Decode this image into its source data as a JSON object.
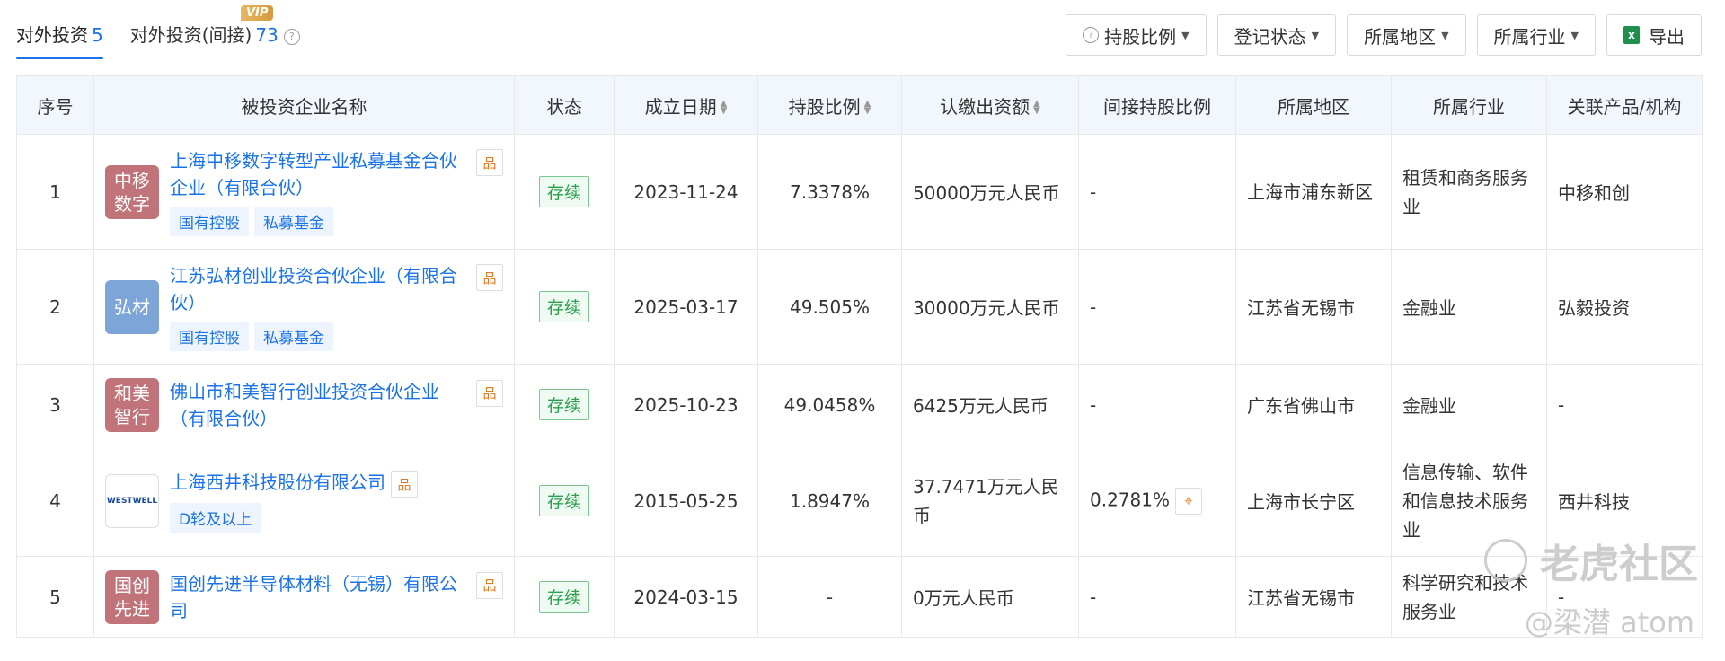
{
  "tabs": [
    {
      "label": "对外投资",
      "count": "5"
    },
    {
      "label": "对外投资(间接)",
      "count": "73"
    }
  ],
  "vip_badge": "VIP",
  "filters": {
    "holding_ratio": "持股比例",
    "reg_status": "登记状态",
    "region": "所属地区",
    "industry": "所属行业",
    "export": "导出"
  },
  "columns": [
    "序号",
    "被投资企业名称",
    "状态",
    "成立日期",
    "持股比例",
    "认缴出资额",
    "间接持股比例",
    "所属地区",
    "所属行业",
    "关联产品/机构"
  ],
  "rows": [
    {
      "index": "1",
      "logo_text": "中移数字",
      "logo_color": "#c0747a",
      "name": "上海中移数字转型产业私募基金合伙企业（有限合伙）",
      "tags": [
        "国有控股",
        "私募基金"
      ],
      "status": "存续",
      "date": "2023-11-24",
      "ratio": "7.3378%",
      "capital": "50000万元人民币",
      "indirect": "-",
      "region": "上海市浦东新区",
      "industry": "租赁和商务服务业",
      "product": "中移和创"
    },
    {
      "index": "2",
      "logo_text": "弘材",
      "logo_color": "#7ea5d8",
      "name": "江苏弘材创业投资合伙企业（有限合伙）",
      "tags": [
        "国有控股",
        "私募基金"
      ],
      "status": "存续",
      "date": "2025-03-17",
      "ratio": "49.505%",
      "capital": "30000万元人民币",
      "indirect": "-",
      "region": "江苏省无锡市",
      "industry": "金融业",
      "product": "弘毅投资"
    },
    {
      "index": "3",
      "logo_text": "和美智行",
      "logo_color": "#c0747a",
      "name": "佛山市和美智行创业投资合伙企业（有限合伙）",
      "tags": [],
      "status": "存续",
      "date": "2025-10-23",
      "ratio": "49.0458%",
      "capital": "6425万元人民币",
      "indirect": "-",
      "region": "广东省佛山市",
      "industry": "金融业",
      "product": "-"
    },
    {
      "index": "4",
      "logo_text": "WESTWELL",
      "logo_color": "#ffffff",
      "name": "上海西井科技股份有限公司",
      "tags": [
        "D轮及以上"
      ],
      "status": "存续",
      "date": "2015-05-25",
      "ratio": "1.8947%",
      "capital": "37.7471万元人民币",
      "indirect": "0.2781%",
      "region": "上海市长宁区",
      "industry": "信息传输、软件和信息技术服务业",
      "product": "西井科技"
    },
    {
      "index": "5",
      "logo_text": "国创先进",
      "logo_color": "#c0747a",
      "name": "国创先进半导体材料（无锡）有限公司",
      "tags": [],
      "status": "存续",
      "date": "2024-03-15",
      "ratio": "-",
      "capital": "0万元人民币",
      "indirect": "-",
      "region": "江苏省无锡市",
      "industry": "科学研究和技术服务业",
      "product": "-"
    }
  ],
  "watermark": {
    "brand": "老虎社区",
    "author": "@梁潜 atom"
  }
}
